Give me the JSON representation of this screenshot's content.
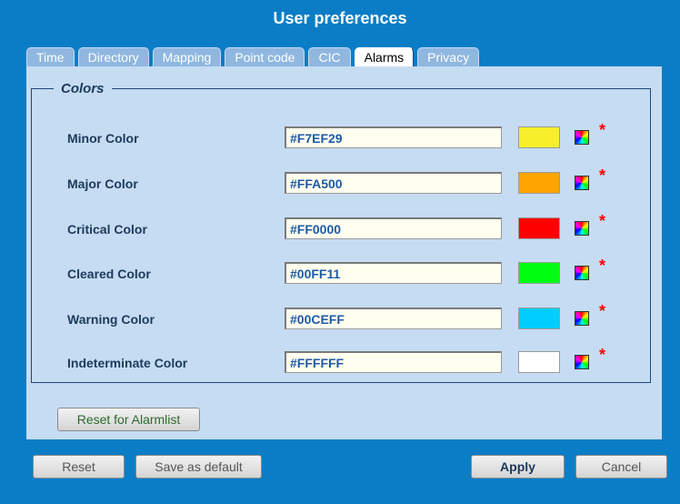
{
  "dialog": {
    "title": "User preferences"
  },
  "tabs": [
    {
      "label": "Time",
      "active": false
    },
    {
      "label": "Directory",
      "active": false
    },
    {
      "label": "Mapping",
      "active": false
    },
    {
      "label": "Point code",
      "active": false
    },
    {
      "label": "CIC",
      "active": false
    },
    {
      "label": "Alarms",
      "active": true
    },
    {
      "label": "Privacy",
      "active": false
    }
  ],
  "colors_section": {
    "legend": "Colors",
    "rows": [
      {
        "label": "Minor Color",
        "value": "#F7EF29",
        "swatch": "#F7EF29",
        "required_marker": "*"
      },
      {
        "label": "Major Color",
        "value": "#FFA500",
        "swatch": "#FFA500",
        "required_marker": "*"
      },
      {
        "label": "Critical Color",
        "value": "#FF0000",
        "swatch": "#FF0000",
        "required_marker": "*"
      },
      {
        "label": "Cleared Color",
        "value": "#00FF11",
        "swatch": "#00FF11",
        "required_marker": "*"
      },
      {
        "label": "Warning Color",
        "value": "#00CEFF",
        "swatch": "#00CEFF",
        "required_marker": "*"
      },
      {
        "label": "Indeterminate Color",
        "value": "#FFFFFF",
        "swatch": "#FFFFFF",
        "required_marker": "*"
      }
    ]
  },
  "reset_alarmlist_label": "Reset for Alarmlist",
  "footer": {
    "reset_label": "Reset",
    "save_default_label": "Save as default",
    "apply_label": "Apply",
    "cancel_label": "Cancel"
  }
}
